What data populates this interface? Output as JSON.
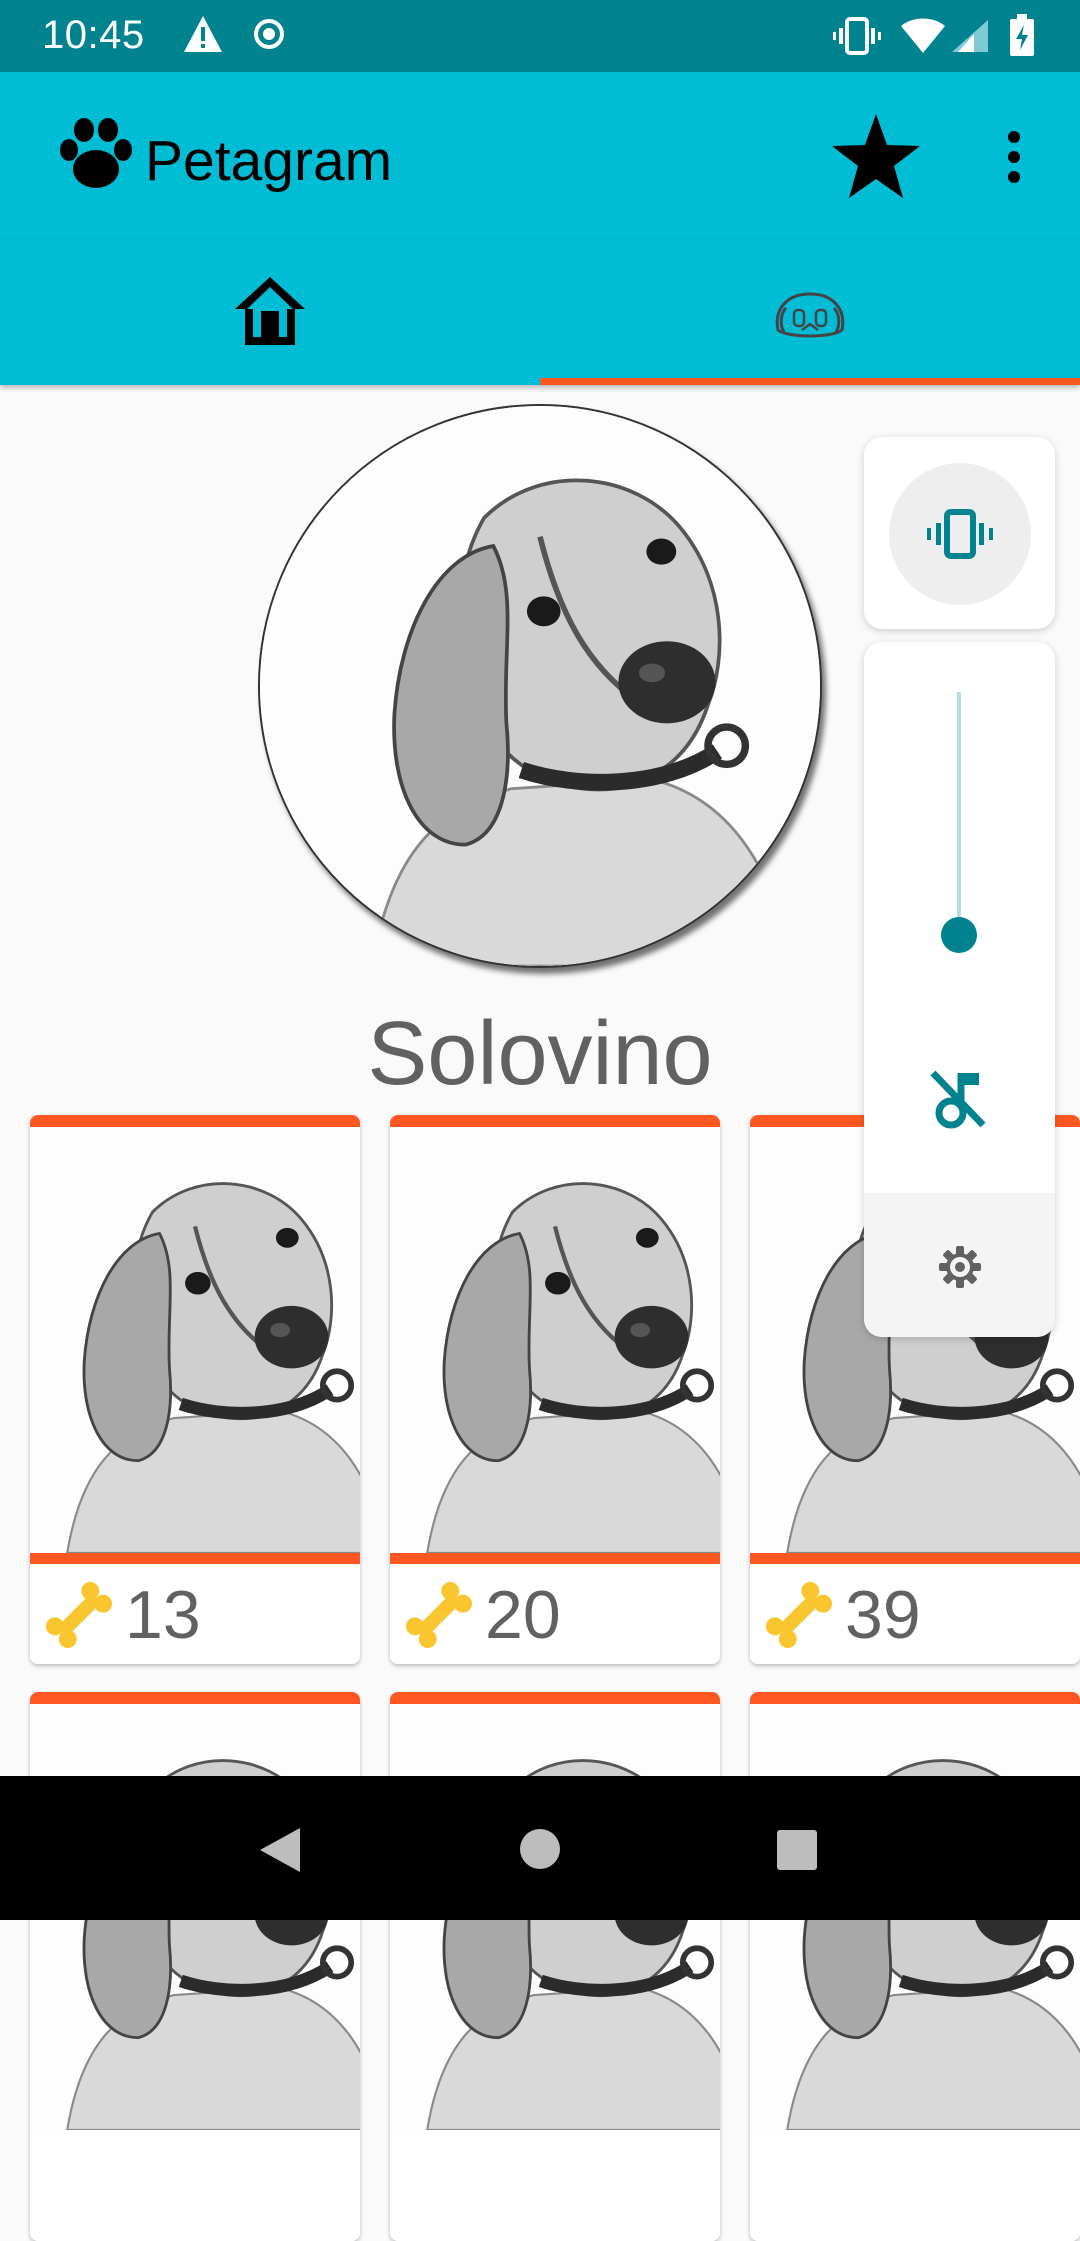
{
  "status_bar": {
    "time": "10:45",
    "icons_left": [
      "warning-icon",
      "target-icon"
    ],
    "icons_right": [
      "vibrate-icon",
      "wifi-icon",
      "signal-icon",
      "battery-charging-icon"
    ]
  },
  "app_bar": {
    "title": "Petagram",
    "logo_icon": "paw-icon",
    "favorites_icon": "star-icon",
    "menu_icon": "more-vert-icon"
  },
  "tabs": [
    {
      "icon": "home-icon",
      "selected": false
    },
    {
      "icon": "dog-face-icon",
      "selected": true
    }
  ],
  "profile": {
    "name": "Solovino"
  },
  "gallery": {
    "like_icon": "bone-icon",
    "items": [
      {
        "likes": "13"
      },
      {
        "likes": "20"
      },
      {
        "likes": "39"
      }
    ]
  },
  "volume_panel": {
    "ringer_mode_icon": "vibrate-icon",
    "level": 0,
    "mute_icon": "music-off-icon",
    "settings_icon": "gear-icon"
  },
  "colors": {
    "status_bar": "#00838f",
    "app_bar": "#00bcd4",
    "accent": "#ff5722",
    "volume_accent": "#00838f"
  }
}
